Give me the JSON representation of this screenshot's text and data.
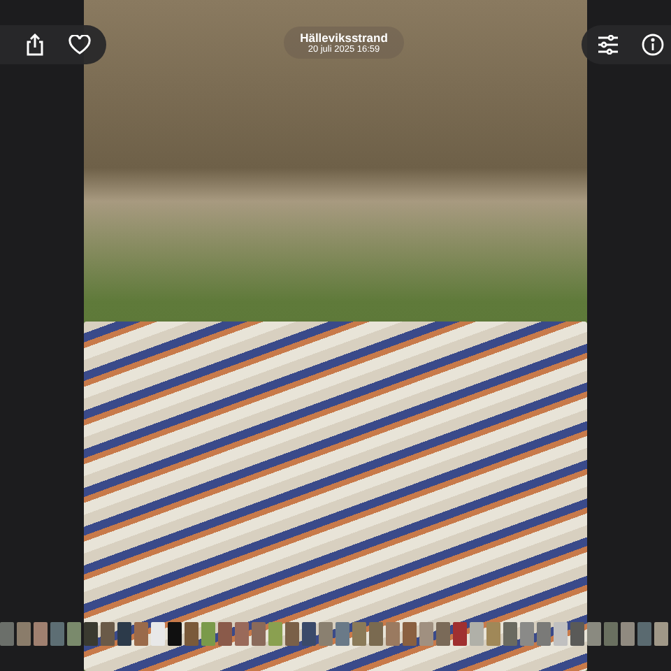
{
  "header": {
    "title": "Hälleviksstrand",
    "subtitle": "20 juli 2025 16:59"
  }
}
